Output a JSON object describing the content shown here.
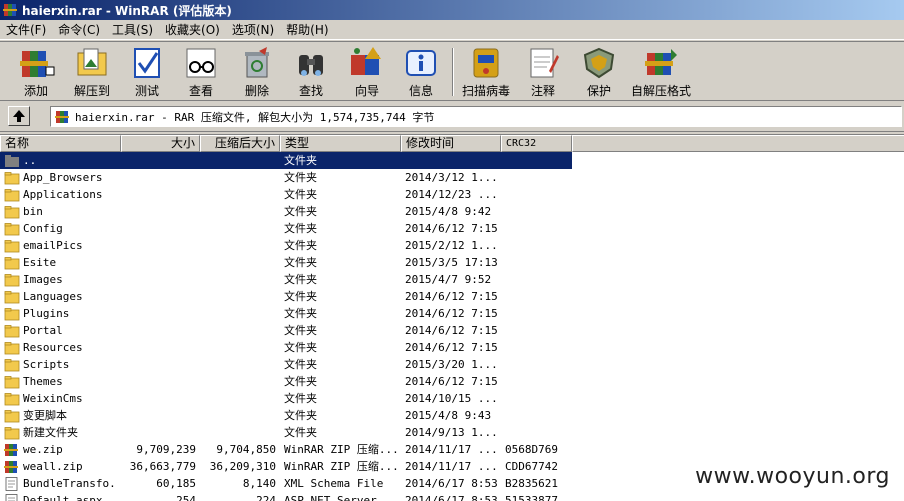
{
  "window": {
    "title": "haierxin.rar - WinRAR (评估版本)"
  },
  "menu": [
    {
      "label": "文件(F)"
    },
    {
      "label": "命令(C)"
    },
    {
      "label": "工具(S)"
    },
    {
      "label": "收藏夹(O)"
    },
    {
      "label": "选项(N)"
    },
    {
      "label": "帮助(H)"
    }
  ],
  "toolbar": [
    {
      "label": "添加",
      "icon": "add-books-icon"
    },
    {
      "label": "解压到",
      "icon": "extract-folder-icon"
    },
    {
      "label": "测试",
      "icon": "test-check-icon"
    },
    {
      "label": "查看",
      "icon": "view-glasses-icon"
    },
    {
      "label": "删除",
      "icon": "delete-recycle-icon"
    },
    {
      "label": "查找",
      "icon": "find-binoculars-icon"
    },
    {
      "label": "向导",
      "icon": "wizard-icon"
    },
    {
      "label": "信息",
      "icon": "info-icon"
    },
    {
      "label": "扫描病毒",
      "icon": "virus-scan-icon"
    },
    {
      "label": "注释",
      "icon": "comment-note-icon"
    },
    {
      "label": "保护",
      "icon": "protect-shield-icon"
    },
    {
      "label": "自解压格式",
      "icon": "sfx-icon"
    }
  ],
  "address": {
    "text": "haierxin.rar - RAR 压缩文件, 解包大小为 1,574,735,744 字节"
  },
  "columns": [
    {
      "label": "名称"
    },
    {
      "label": "大小"
    },
    {
      "label": "压缩后大小"
    },
    {
      "label": "类型"
    },
    {
      "label": "修改时间"
    },
    {
      "label": "CRC32"
    }
  ],
  "files": [
    {
      "name": "..",
      "size": "",
      "packed": "",
      "type": "文件夹",
      "modified": "",
      "crc": "",
      "kind": "up",
      "selected": true
    },
    {
      "name": "App_Browsers",
      "size": "",
      "packed": "",
      "type": "文件夹",
      "modified": "2014/3/12 1...",
      "crc": "",
      "kind": "folder"
    },
    {
      "name": "Applications",
      "size": "",
      "packed": "",
      "type": "文件夹",
      "modified": "2014/12/23 ...",
      "crc": "",
      "kind": "folder"
    },
    {
      "name": "bin",
      "size": "",
      "packed": "",
      "type": "文件夹",
      "modified": "2015/4/8 9:42",
      "crc": "",
      "kind": "folder"
    },
    {
      "name": "Config",
      "size": "",
      "packed": "",
      "type": "文件夹",
      "modified": "2014/6/12 7:15",
      "crc": "",
      "kind": "folder"
    },
    {
      "name": "emailPics",
      "size": "",
      "packed": "",
      "type": "文件夹",
      "modified": "2015/2/12 1...",
      "crc": "",
      "kind": "folder"
    },
    {
      "name": "Esite",
      "size": "",
      "packed": "",
      "type": "文件夹",
      "modified": "2015/3/5 17:13",
      "crc": "",
      "kind": "folder"
    },
    {
      "name": "Images",
      "size": "",
      "packed": "",
      "type": "文件夹",
      "modified": "2015/4/7 9:52",
      "crc": "",
      "kind": "folder"
    },
    {
      "name": "Languages",
      "size": "",
      "packed": "",
      "type": "文件夹",
      "modified": "2014/6/12 7:15",
      "crc": "",
      "kind": "folder"
    },
    {
      "name": "Plugins",
      "size": "",
      "packed": "",
      "type": "文件夹",
      "modified": "2014/6/12 7:15",
      "crc": "",
      "kind": "folder"
    },
    {
      "name": "Portal",
      "size": "",
      "packed": "",
      "type": "文件夹",
      "modified": "2014/6/12 7:15",
      "crc": "",
      "kind": "folder"
    },
    {
      "name": "Resources",
      "size": "",
      "packed": "",
      "type": "文件夹",
      "modified": "2014/6/12 7:15",
      "crc": "",
      "kind": "folder"
    },
    {
      "name": "Scripts",
      "size": "",
      "packed": "",
      "type": "文件夹",
      "modified": "2015/3/20 1...",
      "crc": "",
      "kind": "folder"
    },
    {
      "name": "Themes",
      "size": "",
      "packed": "",
      "type": "文件夹",
      "modified": "2014/6/12 7:15",
      "crc": "",
      "kind": "folder"
    },
    {
      "name": "WeixinCms",
      "size": "",
      "packed": "",
      "type": "文件夹",
      "modified": "2014/10/15 ...",
      "crc": "",
      "kind": "folder"
    },
    {
      "name": "变更脚本",
      "size": "",
      "packed": "",
      "type": "文件夹",
      "modified": "2015/4/8 9:43",
      "crc": "",
      "kind": "folder"
    },
    {
      "name": "新建文件夹",
      "size": "",
      "packed": "",
      "type": "文件夹",
      "modified": "2014/9/13 1...",
      "crc": "",
      "kind": "folder"
    },
    {
      "name": "we.zip",
      "size": "9,709,239",
      "packed": "9,704,850",
      "type": "WinRAR ZIP 压缩...",
      "modified": "2014/11/17 ...",
      "crc": "0568D769",
      "kind": "zip"
    },
    {
      "name": "weall.zip",
      "size": "36,663,779",
      "packed": "36,209,310",
      "type": "WinRAR ZIP 压缩...",
      "modified": "2014/11/17 ...",
      "crc": "CDD67742",
      "kind": "zip"
    },
    {
      "name": "BundleTransfo...",
      "size": "60,185",
      "packed": "8,140",
      "type": "XML Schema File",
      "modified": "2014/6/17 8:53",
      "crc": "B2835621",
      "kind": "file"
    },
    {
      "name": "Default.aspx",
      "size": "254",
      "packed": "224",
      "type": "ASP.NET Server...",
      "modified": "2014/6/17 8:53",
      "crc": "51533877",
      "kind": "file"
    }
  ],
  "watermark": "www.wooyun.org"
}
